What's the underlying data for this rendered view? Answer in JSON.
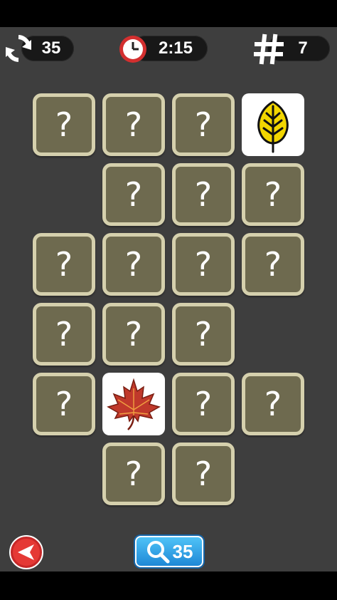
{
  "hud": {
    "moves": "35",
    "time": "2:15",
    "pairs_left": "7",
    "moves_icon": "refresh-icon",
    "time_icon": "clock-icon",
    "pairs_icon": "hash-icon"
  },
  "board": {
    "tiles": [
      {
        "name": "tile-r1-c1",
        "label": "?",
        "state": "hidden"
      },
      {
        "name": "tile-r1-c2",
        "label": "?",
        "state": "hidden"
      },
      {
        "name": "tile-r1-c3",
        "label": "?",
        "state": "hidden"
      },
      {
        "name": "tile-r1-c4",
        "state": "revealed",
        "icon": "yellow-leaf-icon"
      },
      {
        "name": "tile-r2-c2",
        "label": "?",
        "state": "hidden"
      },
      {
        "name": "tile-r2-c3",
        "label": "?",
        "state": "hidden"
      },
      {
        "name": "tile-r2-c4",
        "label": "?",
        "state": "hidden"
      },
      {
        "name": "tile-r3-c1",
        "label": "?",
        "state": "hidden"
      },
      {
        "name": "tile-r3-c2",
        "label": "?",
        "state": "hidden"
      },
      {
        "name": "tile-r3-c3",
        "label": "?",
        "state": "hidden"
      },
      {
        "name": "tile-r3-c4",
        "label": "?",
        "state": "hidden"
      },
      {
        "name": "tile-r4-c1",
        "label": "?",
        "state": "hidden"
      },
      {
        "name": "tile-r4-c2",
        "label": "?",
        "state": "hidden"
      },
      {
        "name": "tile-r4-c3",
        "label": "?",
        "state": "hidden"
      },
      {
        "name": "tile-r5-c1",
        "label": "?",
        "state": "hidden"
      },
      {
        "name": "tile-r5-c2",
        "state": "revealed",
        "icon": "maple-leaf-icon"
      },
      {
        "name": "tile-r5-c3",
        "label": "?",
        "state": "hidden"
      },
      {
        "name": "tile-r5-c4",
        "label": "?",
        "state": "hidden"
      },
      {
        "name": "tile-r6-c2",
        "label": "?",
        "state": "hidden"
      },
      {
        "name": "tile-r6-c3",
        "label": "?",
        "state": "hidden"
      }
    ]
  },
  "footer": {
    "back_icon": "back-arrow-icon",
    "hint_icon": "magnifier-icon",
    "hint_count": "35"
  },
  "colors": {
    "background": "#3e3e3e",
    "tile_face": "#6e6a4f",
    "tile_border": "#d5d0ad",
    "hint_button": "#1e88d6",
    "back_button": "#d62828"
  }
}
